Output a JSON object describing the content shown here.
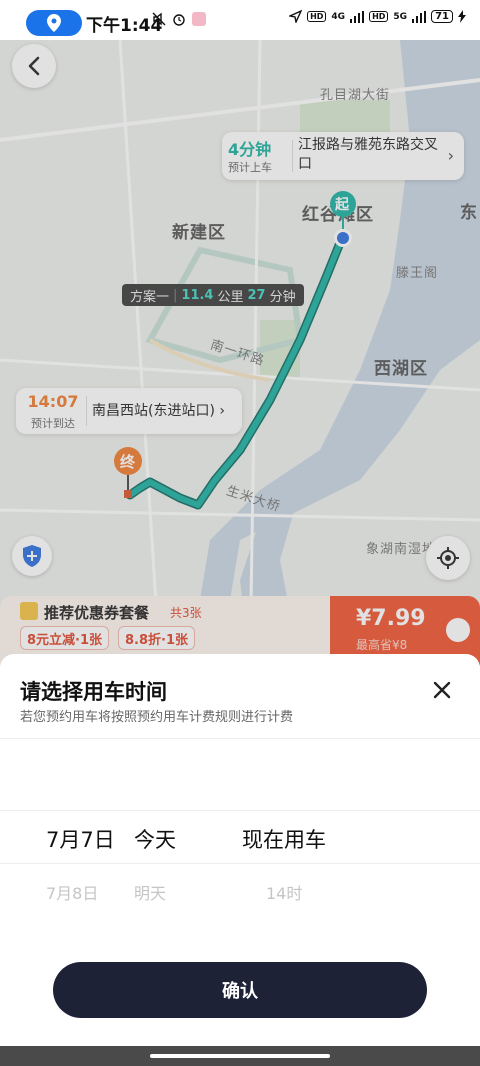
{
  "status_bar": {
    "time": "下午1:44",
    "network_4g": "4G",
    "network_5g": "5G",
    "hd": "HD",
    "battery": "71"
  },
  "map": {
    "labels": {
      "district_xinjian": "新建区",
      "district_honggutan": "红谷滩区",
      "district_xihu": "西湖区",
      "street_kongmuhu": "孔目湖大街",
      "ring_road": "南一环路",
      "bridge": "生米大桥",
      "tengwang": "滕王阁",
      "xiangdong": "象湖南湿地",
      "edge_east": "东"
    },
    "pickup": {
      "minutes": "4分钟",
      "sub": "预计上车",
      "address": "江报路与雅苑东路交叉口"
    },
    "route_chip": {
      "plan": "方案一",
      "distance_value": "11.4",
      "distance_unit": "公里",
      "duration_value": "27",
      "duration_unit": "分钟"
    },
    "arrive": {
      "time": "14:07",
      "sub": "预计到达",
      "address": "南昌西站(东进站口)"
    },
    "start_marker": "起",
    "end_marker": "终"
  },
  "coupon": {
    "title": "推荐优惠券套餐",
    "count": "共3张",
    "tag1": "8元立减·1张",
    "tag2": "8.8折·1张",
    "price": "¥7.99",
    "save": "最高省¥8"
  },
  "sheet": {
    "title": "请选择用车时间",
    "subtitle": "若您预约用车将按照预约用车计费规则进行计费",
    "selected": {
      "date": "7月7日",
      "day": "今天",
      "time": "现在用车"
    },
    "next": {
      "date": "7月8日",
      "day": "明天",
      "time": "14时"
    },
    "confirm_label": "确认"
  },
  "colors": {
    "route": "#1ab0a0",
    "start_marker": "#1ab0a0",
    "end_marker": "#f07a2c",
    "confirm_bg": "#1d2237",
    "coupon_price_bg": "#f0522f"
  }
}
